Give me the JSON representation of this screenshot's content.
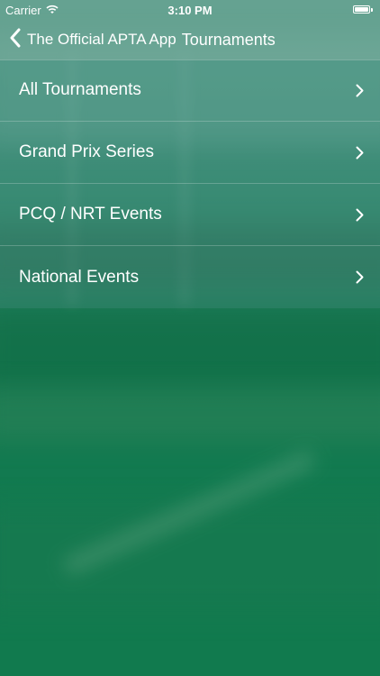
{
  "status_bar": {
    "carrier": "Carrier",
    "time": "3:10 PM",
    "icons": [
      "wifi-icon",
      "battery-icon"
    ]
  },
  "nav": {
    "back_label": "The Official APTA App",
    "title": "Tournaments"
  },
  "menu": {
    "items": [
      {
        "label": "All Tournaments"
      },
      {
        "label": "Grand Prix Series"
      },
      {
        "label": "PCQ / NRT Events"
      },
      {
        "label": "National Events"
      }
    ]
  },
  "colors": {
    "background_top": "#4f9a86",
    "background_bottom": "#117a4e",
    "text": "#ffffff"
  }
}
